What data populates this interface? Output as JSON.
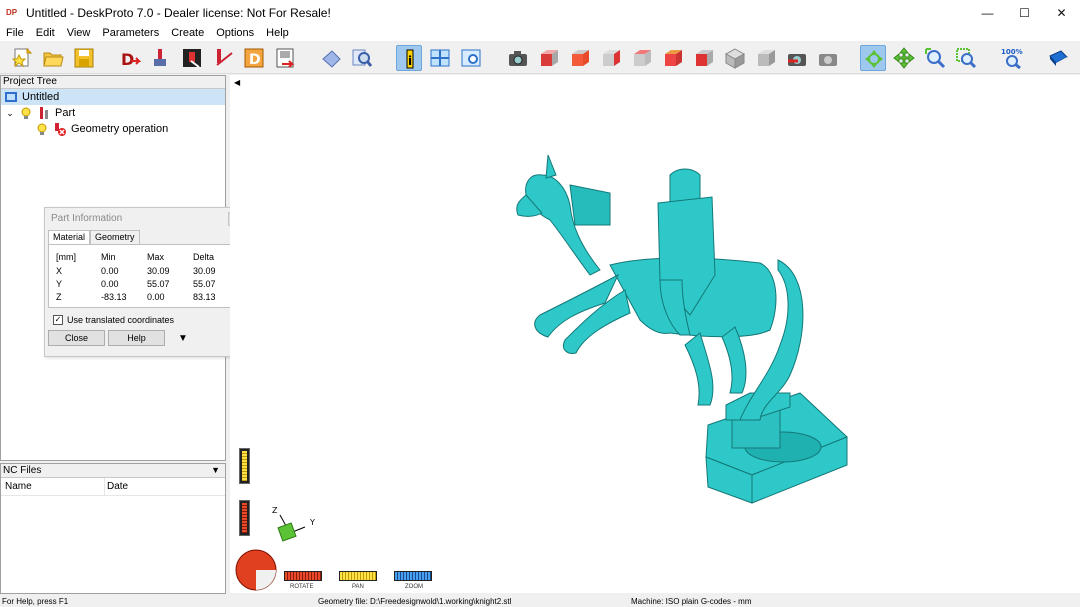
{
  "window": {
    "icon_text": "DP",
    "title": "Untitled - DeskProto 7.0 - Dealer license: Not For Resale!",
    "minimize": "—",
    "maximize": "☐",
    "close": "✕"
  },
  "menu": [
    "File",
    "Edit",
    "View",
    "Parameters",
    "Create",
    "Options",
    "Help"
  ],
  "toolbar": {
    "zoom_label": "100%"
  },
  "project_tree": {
    "title": "Project Tree",
    "root": "Untitled",
    "part": "Part",
    "operation": "Geometry operation"
  },
  "nc_files": {
    "title": "NC Files",
    "col_name": "Name",
    "col_date": "Date"
  },
  "part_info": {
    "title": "Part Information",
    "tabs": [
      "Material",
      "Geometry"
    ],
    "header": [
      "[mm]",
      "Min",
      "Max",
      "Delta"
    ],
    "rows": [
      [
        "X",
        "0.00",
        "30.09",
        "30.09"
      ],
      [
        "Y",
        "0.00",
        "55.07",
        "55.07"
      ],
      [
        "Z",
        "-83.13",
        "0.00",
        "83.13"
      ]
    ],
    "checkbox_label": "Use translated coordinates",
    "checkbox_checked": true,
    "close_button": "Close",
    "help_button": "Help"
  },
  "view_controls": {
    "rotate": "ROTATE",
    "pan": "PAN",
    "zoom": "ZOOM"
  },
  "axes": {
    "z": "Z",
    "y": "Y"
  },
  "status": {
    "help": "For Help, press F1",
    "geometry_file": "Geometry file: D:\\Freedesignwold\\1.working\\knight2.stl",
    "machine": "Machine: ISO plain G-codes - mm"
  },
  "colors": {
    "model": "#2ec8c8",
    "accent": "#9fc8ef"
  }
}
